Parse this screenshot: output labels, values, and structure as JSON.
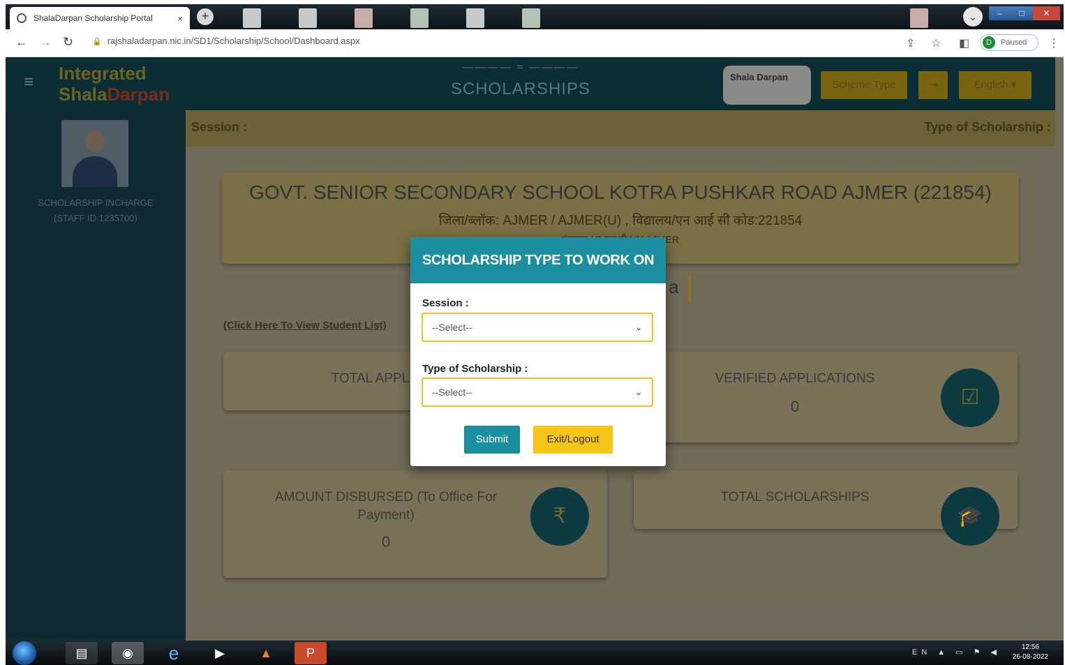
{
  "browser": {
    "tab_title": "ShalaDarpan Scholarship Portal",
    "tab_close": "×",
    "new_tab": "+",
    "url": "rajshaladarpan.nic.in/SD1/Scholarship/School/Dashboard.aspx",
    "profile_letter": "D",
    "profile_status": "Paused"
  },
  "header": {
    "brand_line1": "Integrated",
    "brand_line2a": "Shala",
    "brand_line2b": "Darpan",
    "title": "SCHOLARSHIPS",
    "logo_text": "Shala Darpan",
    "scheme_type_btn": "Scheme Type",
    "logout_icon": "⇥",
    "language": "English"
  },
  "sidebar": {
    "role": "SCHOLARSHIP INCHARGE",
    "staff_id": "(STAFF ID:1235700)"
  },
  "session_bar": {
    "session_label": "Session :",
    "type_label": "Type of Scholarship :"
  },
  "school": {
    "name": "GOVT. SENIOR SECONDARY SCHOOL KOTRA PUSHKAR ROAD AJMER (221854)",
    "district_line": "जिला/ब्लॉक: AJMER / AJMER(U) , विद्यालय/एन आई सी कोड:221854",
    "sub_line": "पंचायत / यू एल बी:NN AJMER"
  },
  "view_link": "(Click Here To View Student List)",
  "stats": {
    "total_applications": "TOTAL APPLIC",
    "verified_applications": "VERIFIED APPLICATIONS",
    "verified_value": "0",
    "amount_disbursed": "AMOUNT DISBURSED (To Office For Payment)",
    "amount_value": "0",
    "total_scholarships": "TOTAL SCHOLARSHIPS"
  },
  "modal": {
    "title": "SCHOLARSHIP TYPE TO WORK ON",
    "session_label": "Session :",
    "session_value": "--Select--",
    "type_label": "Type of Scholarship :",
    "type_value": "--Select--",
    "submit": "Submit",
    "exit": "Exit/Logout"
  },
  "taskbar": {
    "lang": "EN",
    "time": "12:56",
    "date": "26-08-2022"
  },
  "colors": {
    "modal_header": "#1b8fa0",
    "exit_button": "#f7c41a",
    "select_border": "#f2c21a"
  }
}
